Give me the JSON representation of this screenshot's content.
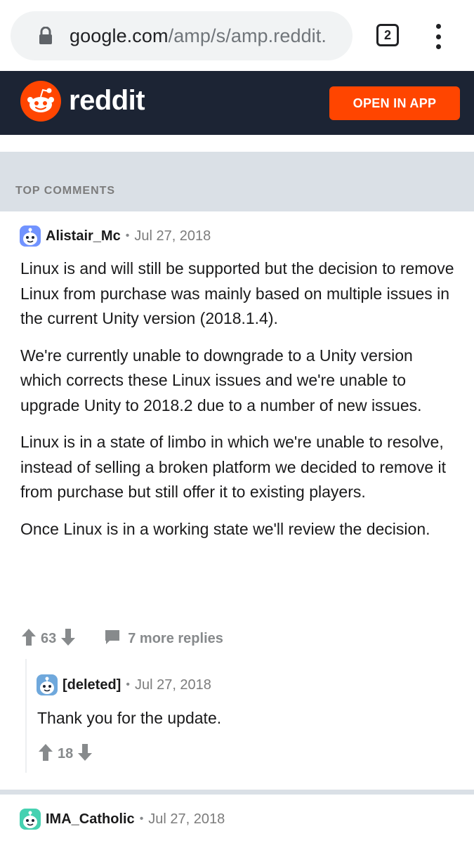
{
  "browser": {
    "url_domain": "google.com",
    "url_path": "/amp/s/amp.reddit.",
    "tab_count": "2"
  },
  "header": {
    "wordmark": "reddit",
    "open_app_label": "OPEN IN APP"
  },
  "section": {
    "title": "TOP COMMENTS"
  },
  "comments": [
    {
      "author": "Alistair_Mc",
      "date": "Jul 27, 2018",
      "paragraphs": [
        "Linux is and will still be supported but the decision to remove Linux from purchase was mainly based on multiple issues in the current Unity version (2018.1.4).",
        "We're currently unable to downgrade to a Unity version which corrects these Linux issues and we're unable to upgrade Unity to 2018.2 due to a number of new issues.",
        "Linux is in a state of limbo in which we're unable to resolve, instead of selling a broken platform we decided to remove it from purchase but still offer it to existing players.",
        "Once Linux is in a working state we'll review the decision."
      ],
      "score": "63",
      "replies_label": "7 more replies"
    },
    {
      "author": "[deleted]",
      "date": "Jul 27, 2018",
      "text": "Thank you for the update.",
      "score": "18"
    },
    {
      "author": "IMA_Catholic",
      "date": "Jul 27, 2018"
    }
  ],
  "colors": {
    "brand": "#ff4500",
    "header_bg": "#1c2434",
    "section_bg": "#dae0e6",
    "meta_gray": "#878a8c"
  },
  "icons": [
    "lock-icon",
    "tab-switcher-icon",
    "more-menu-icon",
    "reddit-snoo-icon",
    "upvote-icon",
    "downvote-icon",
    "comment-bubble-icon",
    "snoo-avatar-icon"
  ]
}
